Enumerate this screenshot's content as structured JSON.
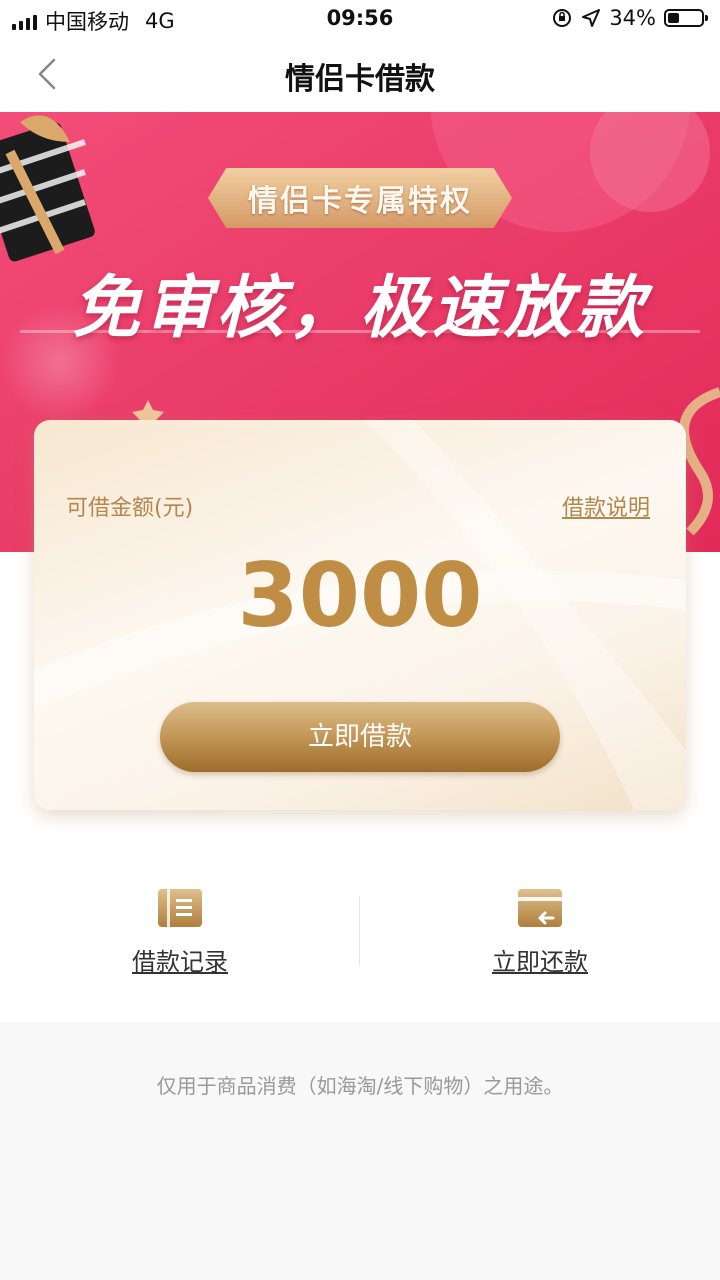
{
  "status_bar": {
    "carrier": "中国移动",
    "network": "4G",
    "time": "09:56",
    "battery_percent": "34%",
    "battery_level": 0.34
  },
  "nav": {
    "title": "情侣卡借款",
    "back_icon": "chevron-left-icon"
  },
  "banner": {
    "ribbon": "情侣卡专属特权",
    "headline": "免审核，极速放款",
    "colors": {
      "primary": "#ee3a6a",
      "secondary": "#e82d5c"
    }
  },
  "card": {
    "amount_label": "可借金额(元)",
    "info_link": "借款说明",
    "amount": "3000",
    "borrow_button": "立即借款"
  },
  "actions": [
    {
      "label": "借款记录",
      "icon": "document-list-icon"
    },
    {
      "label": "立即还款",
      "icon": "card-return-icon"
    }
  ],
  "footer": {
    "note": "仅用于商品消费（如海淘/线下购物）之用途。"
  },
  "colors": {
    "gold": "#bf8d44",
    "gold_dark": "#9e6c2c",
    "pink": "#ee3a6a"
  }
}
